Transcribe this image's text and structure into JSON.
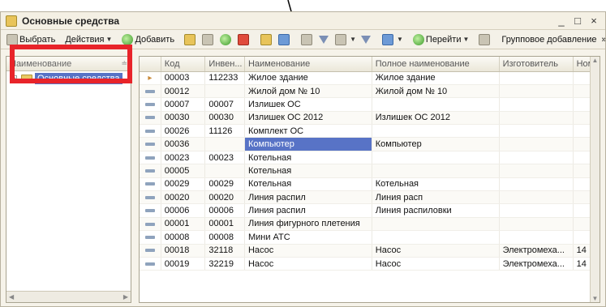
{
  "window": {
    "title": "Основные средства",
    "min_glyph": "_",
    "max_glyph": "□",
    "close_glyph": "×"
  },
  "toolbar": {
    "select_label": "Выбрать",
    "actions_label": "Действия",
    "add_label": "Добавить",
    "goto_label": "Перейти",
    "group_add_label": "Групповое добавление",
    "more_glyph": "»"
  },
  "tree": {
    "header": "Наименование",
    "sort_glyph": "≐",
    "expander_glyph": "⊕",
    "root_label": "Основные средства"
  },
  "grid": {
    "columns": [
      "",
      "Код",
      "Инвен...",
      "Наименование",
      "Полное наименование",
      "Изготовитель",
      "Ном"
    ],
    "rows": [
      {
        "mark": "arrow",
        "code": "00003",
        "inv": "112233",
        "name": "Жилое здание",
        "full": "Жилое здание",
        "maker": "",
        "num": ""
      },
      {
        "mark": "dash",
        "code": "00012",
        "inv": "",
        "name": "Жилой дом № 10",
        "full": "Жилой дом № 10",
        "maker": "",
        "num": ""
      },
      {
        "mark": "dash",
        "code": "00007",
        "inv": "00007",
        "name": "Излишек ОС",
        "full": "",
        "maker": "",
        "num": ""
      },
      {
        "mark": "dash",
        "code": "00030",
        "inv": "00030",
        "name": "Излишек ОС 2012",
        "full": "Излишек ОС 2012",
        "maker": "",
        "num": ""
      },
      {
        "mark": "dash",
        "code": "00026",
        "inv": "11126",
        "name": "Комплект ОС",
        "full": "",
        "maker": "",
        "num": ""
      },
      {
        "mark": "dash",
        "code": "00036",
        "inv": "",
        "name": "Компьютер",
        "full": "Компьютер",
        "maker": "",
        "num": "",
        "selected": true
      },
      {
        "mark": "dash",
        "code": "00023",
        "inv": "00023",
        "name": "Котельная",
        "full": "",
        "maker": "",
        "num": ""
      },
      {
        "mark": "dash",
        "code": "00005",
        "inv": "",
        "name": "Котельная",
        "full": "",
        "maker": "",
        "num": ""
      },
      {
        "mark": "dash",
        "code": "00029",
        "inv": "00029",
        "name": "Котельная",
        "full": "Котельная",
        "maker": "",
        "num": ""
      },
      {
        "mark": "dash",
        "code": "00020",
        "inv": "00020",
        "name": "Линия распил",
        "full": "Линия расп",
        "maker": "",
        "num": ""
      },
      {
        "mark": "dash",
        "code": "00006",
        "inv": "00006",
        "name": "Линия распил",
        "full": "Линия распиловки",
        "maker": "",
        "num": ""
      },
      {
        "mark": "dash",
        "code": "00001",
        "inv": "00001",
        "name": "Линия фигурного плетения",
        "full": "",
        "maker": "",
        "num": ""
      },
      {
        "mark": "dash",
        "code": "00008",
        "inv": "00008",
        "name": "Мини АТС",
        "full": "",
        "maker": "",
        "num": ""
      },
      {
        "mark": "dash",
        "code": "00018",
        "inv": "32118",
        "name": "Насос",
        "full": "Насос",
        "maker": "Электромеха...",
        "num": "14"
      },
      {
        "mark": "dash",
        "code": "00019",
        "inv": "32219",
        "name": "Насос",
        "full": "Насос",
        "maker": "Электромеха...",
        "num": "14"
      }
    ]
  },
  "colors": {
    "selection": "#5873c6",
    "highlight": "#e8242a"
  }
}
